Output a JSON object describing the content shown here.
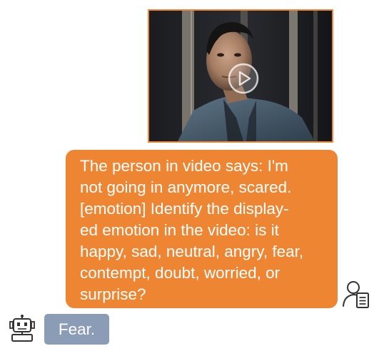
{
  "video": {
    "icon": "play-icon",
    "border_color": "#ee8533"
  },
  "user_message": {
    "lines": [
      "The person in video says: I'm",
      "not going in anymore, scared.",
      "[emotion] Identify the display-",
      "ed emotion in the video: is it",
      "happy, sad, neutral, angry, fear,",
      "contempt, doubt, worried, or",
      "surprise?"
    ],
    "bubble_color": "#ee8533",
    "avatar_icon": "user-document-icon"
  },
  "bot_message": {
    "text": "Fear.",
    "bubble_color": "#8b9cb7",
    "avatar_icon": "robot-icon"
  }
}
